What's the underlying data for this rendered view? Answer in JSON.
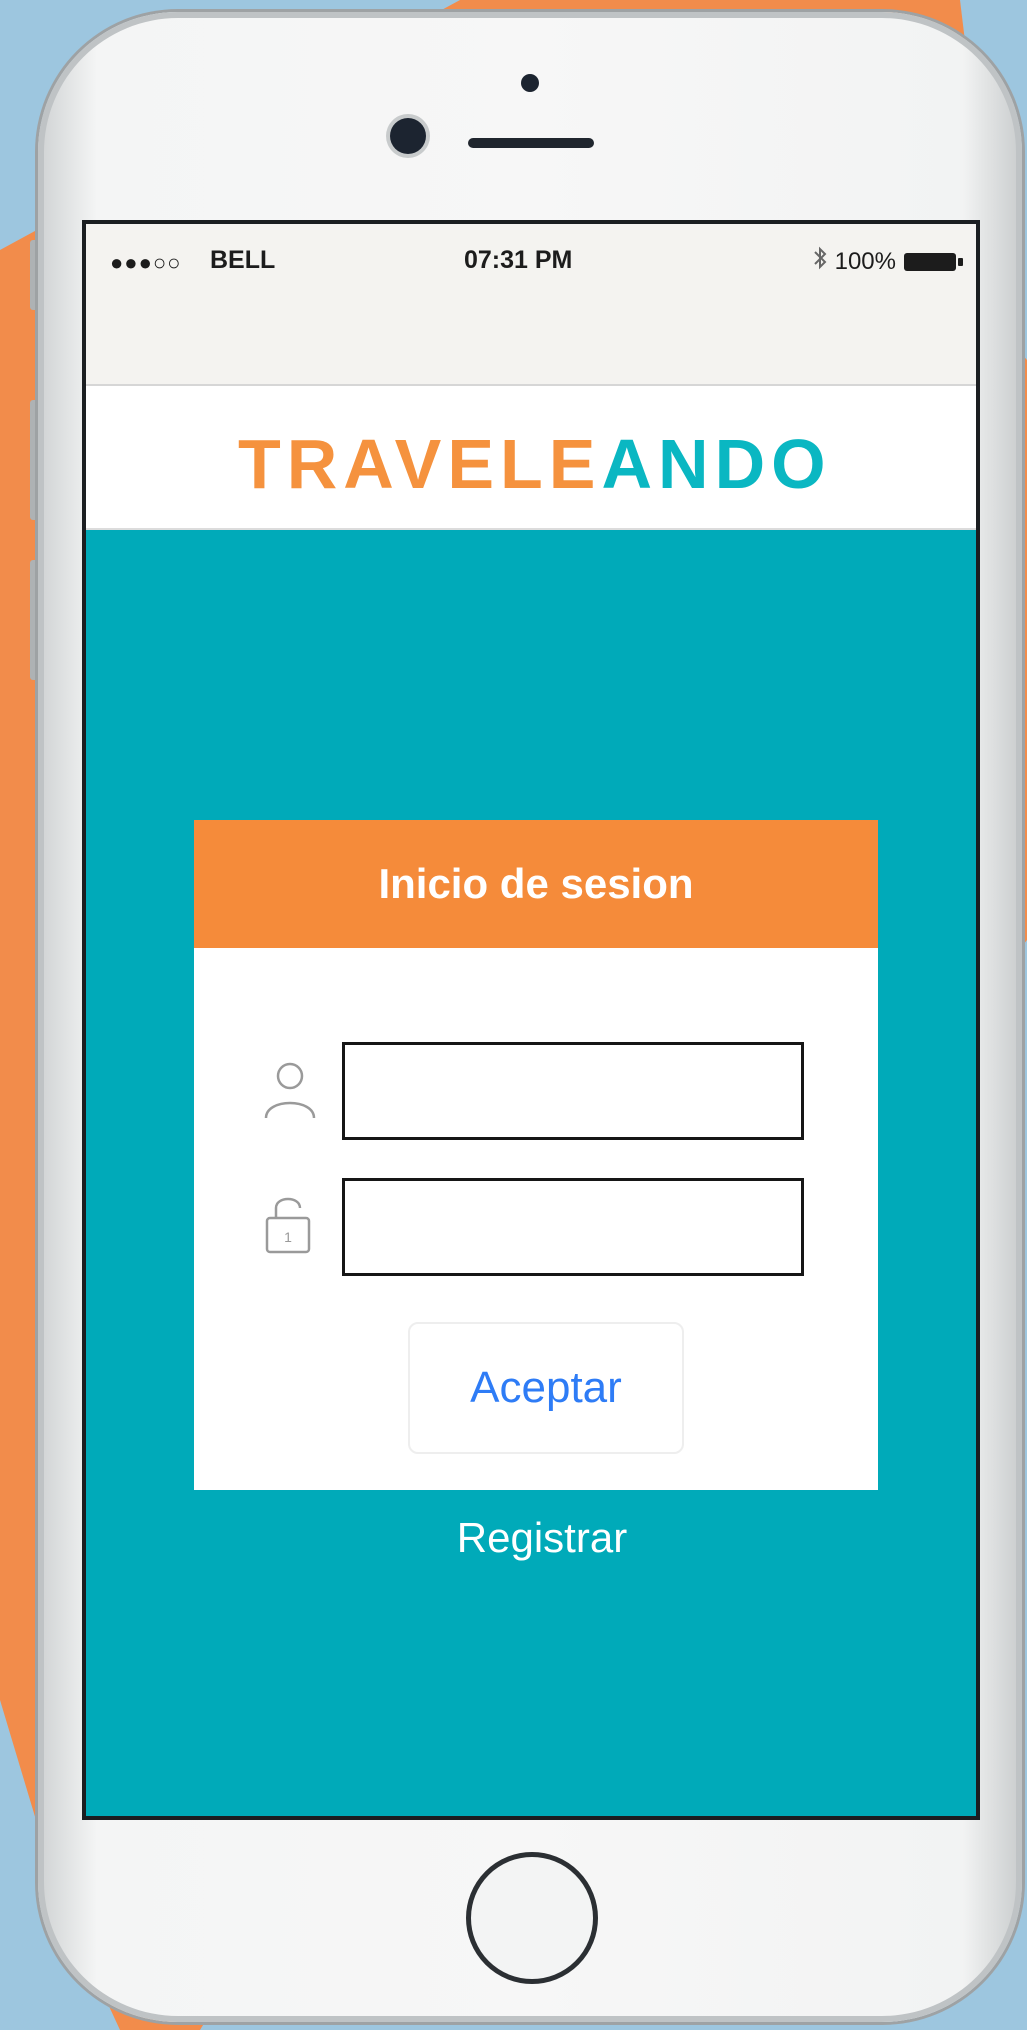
{
  "colors": {
    "background_orange": "#f28c4b",
    "background_blue": "#9dc6df",
    "screen_teal": "#00aab9",
    "header_orange": "#f58b3a",
    "logo_orange": "#f5923e",
    "logo_teal": "#0ab7c2",
    "button_text_blue": "#2e7cf6"
  },
  "status_bar": {
    "signal": "●●●○○",
    "carrier": "BELL",
    "time": "07:31 PM",
    "bluetooth_icon": "bluetooth-icon",
    "battery_percent": "100%",
    "battery_icon": "battery-icon"
  },
  "logo": {
    "part1": "TRAVELE",
    "part2": "ANDO"
  },
  "login_card": {
    "title": "Inicio de sesion",
    "username_field": {
      "icon": "user-icon",
      "value": "",
      "placeholder": ""
    },
    "password_field": {
      "icon": "lock-icon",
      "value": "",
      "placeholder": ""
    },
    "accept_label": "Aceptar"
  },
  "register_link": "Registrar"
}
